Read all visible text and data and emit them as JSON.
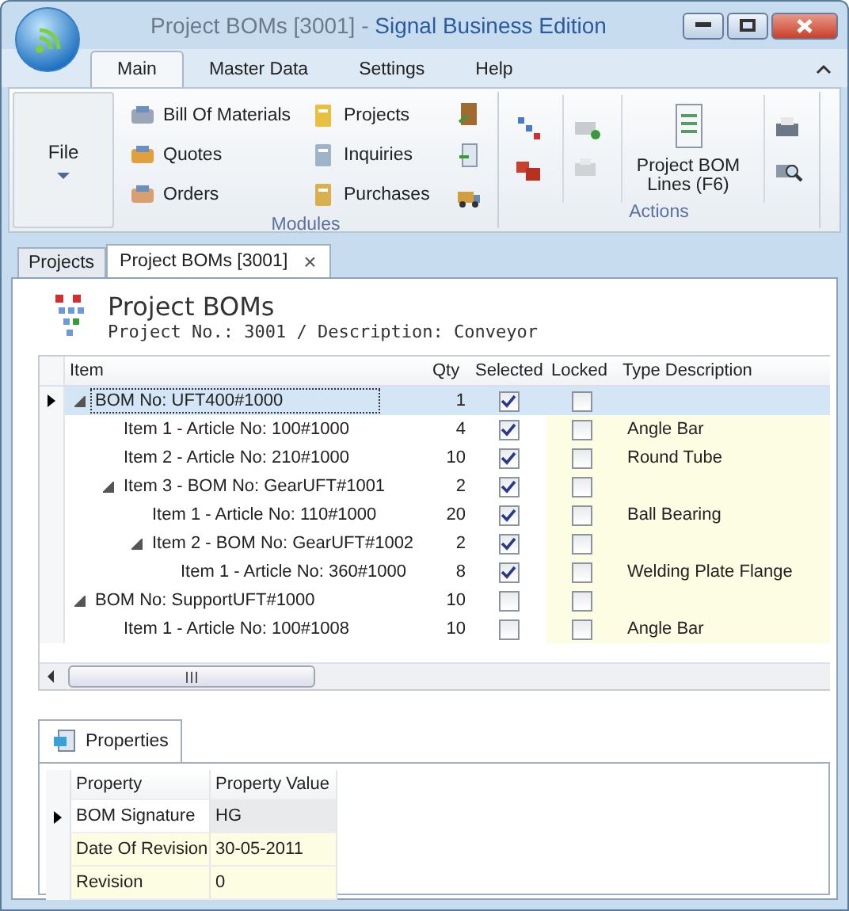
{
  "window": {
    "document_title": "Project BOMs [3001] - ",
    "app_name": "Signal Business Edition"
  },
  "ribbon_tabs": [
    {
      "label": "Main",
      "selected": true
    },
    {
      "label": "Master Data",
      "selected": false
    },
    {
      "label": "Settings",
      "selected": false
    },
    {
      "label": "Help",
      "selected": false
    }
  ],
  "file_button": {
    "label": "File"
  },
  "modules": {
    "label": "Modules",
    "items": [
      "Bill Of Materials",
      "Quotes",
      "Orders",
      "Projects",
      "Inquiries",
      "Purchases"
    ]
  },
  "actions": {
    "label": "Actions",
    "big_button": "Project BOM Lines (F6)"
  },
  "document_tabs": [
    {
      "label": "Projects",
      "selected": false,
      "closable": false
    },
    {
      "label": "Project BOMs [3001]",
      "selected": true,
      "closable": true
    }
  ],
  "close_glyph": "×",
  "header": {
    "title": "Project BOMs",
    "subtitle": "Project No.: 3001 / Description: Conveyor"
  },
  "grid": {
    "columns": [
      "Item",
      "Qty",
      "Selected",
      "Locked",
      "Type Description"
    ],
    "rows": [
      {
        "item": "BOM No: UFT400#1000",
        "qty": "1",
        "checked_selected": true,
        "locked": false,
        "selected": true,
        "expanded": true,
        "children": [
          {
            "item": "Item 1 - Article No: 100#1000",
            "qty": "4",
            "checked_selected": true,
            "locked": false,
            "type_description": "Angle Bar",
            "selected": false
          },
          {
            "item": "Item 2 - Article No: 210#1000",
            "qty": "10",
            "checked_selected": true,
            "locked": false,
            "type_description": "Round Tube",
            "selected": false
          },
          {
            "item": "Item 3 - BOM No: GearUFT#1001",
            "qty": "2",
            "checked_selected": true,
            "locked": false,
            "selected": false,
            "expanded": true,
            "children": [
              {
                "item": "Item 1 - Article No: 110#1000",
                "qty": "20",
                "checked_selected": true,
                "locked": false,
                "type_description": "Ball Bearing",
                "selected": false
              },
              {
                "item": "Item 2 - BOM No: GearUFT#1002",
                "qty": "2",
                "checked_selected": true,
                "locked": false,
                "selected": false,
                "expanded": true,
                "children": [
                  {
                    "item": "Item 1 - Article No: 360#1000",
                    "qty": "8",
                    "checked_selected": true,
                    "locked": false,
                    "type_description": "Welding Plate Flange",
                    "selected": false
                  }
                ]
              }
            ]
          }
        ]
      },
      {
        "item": "BOM No: SupportUFT#1000",
        "qty": "10",
        "checked_selected": false,
        "locked": false,
        "selected": false,
        "expanded": true,
        "children": [
          {
            "item": "Item 1 - Article No: 100#1008",
            "qty": "10",
            "checked_selected": false,
            "locked": false,
            "type_description": "Angle Bar",
            "selected": false
          }
        ]
      }
    ]
  },
  "properties": {
    "tab": "Properties",
    "columns": [
      "Property",
      "Property Value"
    ],
    "rows": [
      {
        "property": "BOM Signature",
        "value": "HG",
        "selected": true
      },
      {
        "property": "Date Of Revision",
        "value": "30-05-2011",
        "selected": false
      },
      {
        "property": "Revision",
        "value": "0",
        "selected": false
      }
    ]
  }
}
